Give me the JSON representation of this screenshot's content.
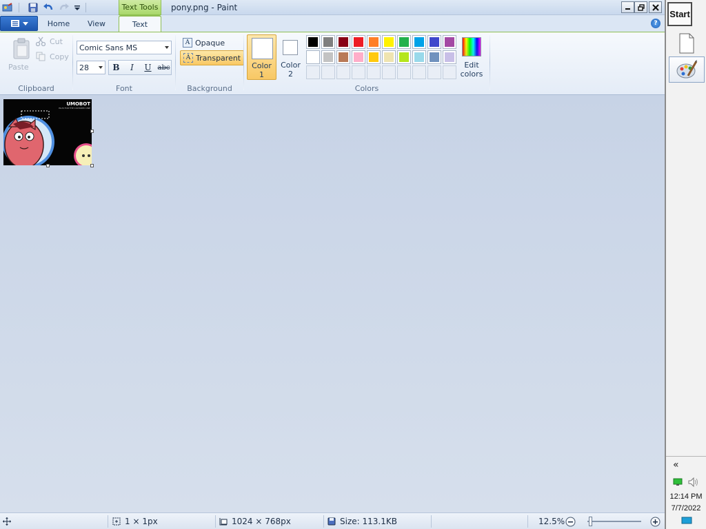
{
  "window": {
    "context_tab": "Text Tools",
    "title": "pony.png - Paint"
  },
  "tabs": [
    {
      "label": "Home"
    },
    {
      "label": "View"
    },
    {
      "label": "Text",
      "active": true
    }
  ],
  "ribbon": {
    "clipboard": {
      "paste": "Paste",
      "cut": "Cut",
      "copy": "Copy",
      "group": "Clipboard"
    },
    "font": {
      "family": "Comic Sans MS",
      "size": "28",
      "bold": "B",
      "italic": "I",
      "underline": "U",
      "strikethrough": "abc",
      "group": "Font"
    },
    "background": {
      "opaque": "Opaque",
      "transparent": "Transparent",
      "selected": "transparent",
      "group": "Background"
    },
    "colors": {
      "color1_label": "Color 1",
      "color1_line1": "Color",
      "color1_line2": "1",
      "color2_line1": "Color",
      "color2_line2": "2",
      "color1_value": "#ffffff",
      "color2_value": "#ffffff",
      "edit_line1": "Edit",
      "edit_line2": "colors",
      "group": "Colors",
      "palette_row1": [
        "#000000",
        "#7f7f7f",
        "#880015",
        "#ed1c24",
        "#ff7f27",
        "#fff200",
        "#22b14c",
        "#00a2e8",
        "#3f48cc",
        "#a349a4"
      ],
      "palette_row2": [
        "#ffffff",
        "#c3c3c3",
        "#b97a57",
        "#ffaec9",
        "#ffc90e",
        "#efe4b0",
        "#b5e61d",
        "#99d9ea",
        "#7092be",
        "#c8bfe7"
      ]
    }
  },
  "image": {
    "logo_text": "UMOBOT",
    "tagline": "PLUS FOR THE CULTURED ONE"
  },
  "status": {
    "cursor_size": "1 × 1px",
    "image_dims": "1024 × 768px",
    "file_size": "Size: 113.1KB",
    "zoom": "12.5%"
  },
  "taskbar": {
    "start": "Start",
    "time": "12:14 PM",
    "date": "7/7/2022",
    "collapse": "«"
  },
  "icons": [
    "app-menu-icon",
    "save-icon",
    "undo-icon",
    "redo-icon",
    "customize-icon",
    "minimize-icon",
    "restore-icon",
    "close-icon",
    "help-icon",
    "paste-icon",
    "cut-icon",
    "copy-icon",
    "opaque-icon",
    "transparent-icon",
    "pixel-cursor-icon",
    "image-size-icon",
    "file-size-icon",
    "zoom-out-icon",
    "zoom-in-icon",
    "new-document-icon",
    "paint-app-icon",
    "network-icon",
    "volume-icon",
    "desktop-icon"
  ]
}
